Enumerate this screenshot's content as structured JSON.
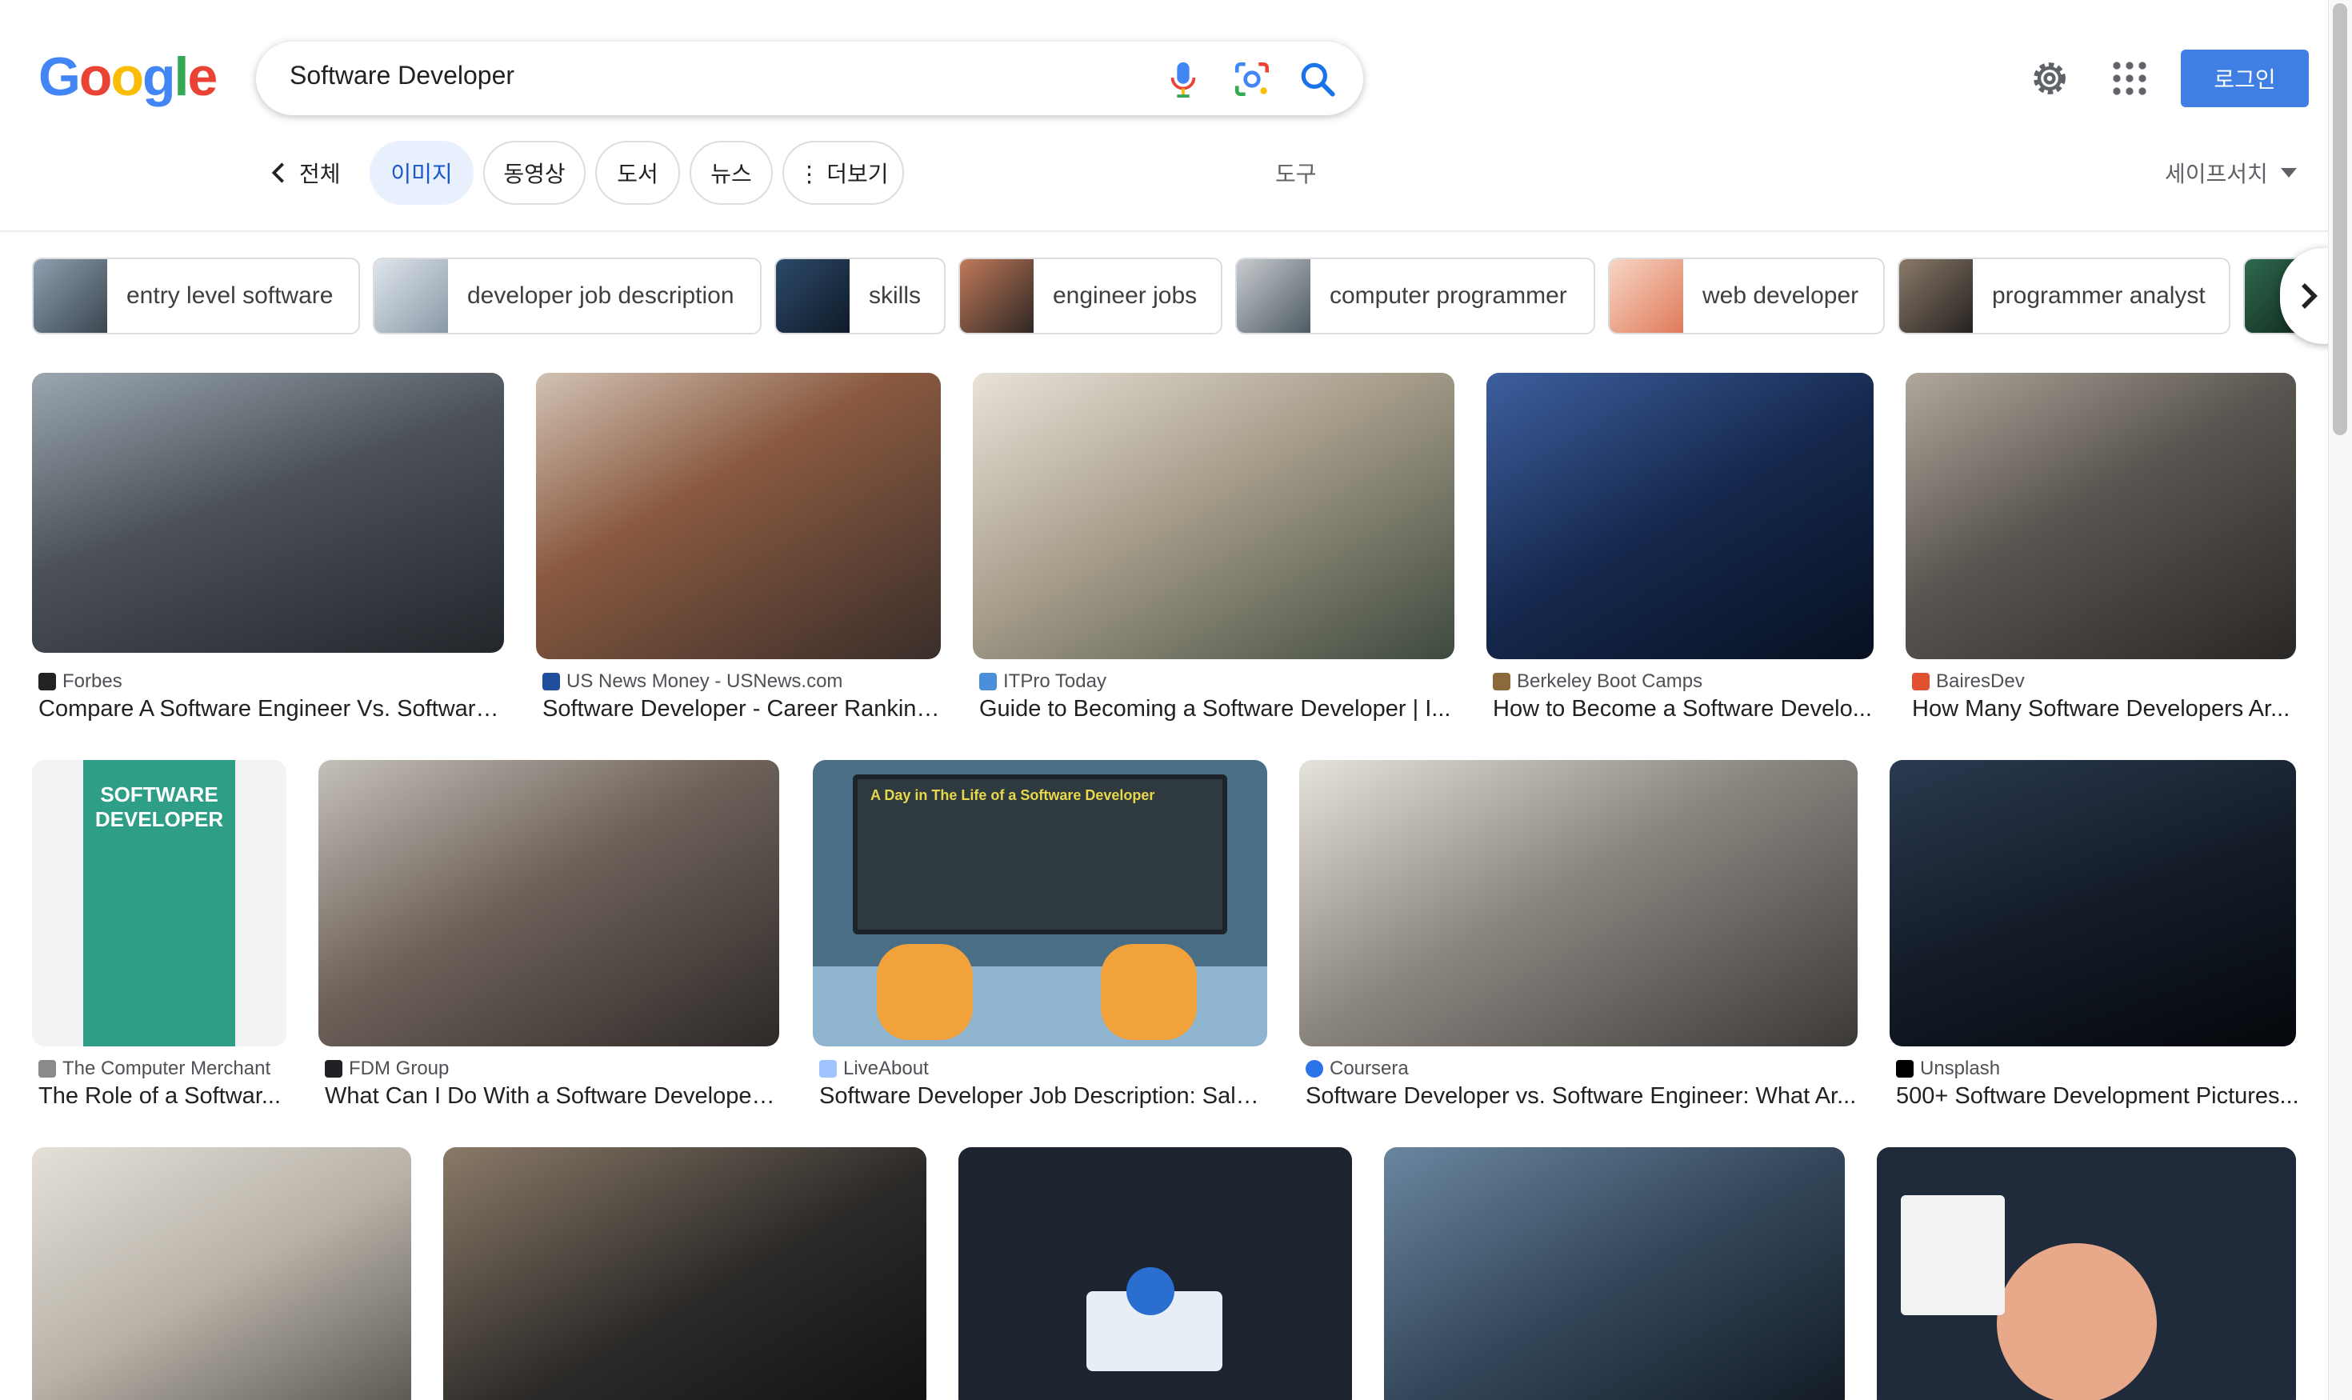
{
  "logo": {
    "letters": [
      "G",
      "o",
      "o",
      "g",
      "l",
      "e"
    ],
    "colors": [
      "#4285f4",
      "#ea4335",
      "#fbbc05",
      "#4285f4",
      "#34a853",
      "#ea4335"
    ]
  },
  "search": {
    "query": "Software Developer"
  },
  "header": {
    "login_label": "로그인"
  },
  "tabs": {
    "back_label": "전체",
    "items": [
      {
        "label": "이미지",
        "active": true
      },
      {
        "label": "동영상"
      },
      {
        "label": "도서"
      },
      {
        "label": "뉴스"
      },
      {
        "label": "⋮ 더보기"
      }
    ],
    "tools": "도구",
    "safesearch": "세이프서치"
  },
  "chips": [
    {
      "label": "entry level software",
      "color": "#5a6a7a"
    },
    {
      "label": "developer job description",
      "color": "#8a98a6"
    },
    {
      "label": "skills",
      "color": "#1f3348"
    },
    {
      "label": "engineer jobs",
      "color": "#4a3a34"
    },
    {
      "label": "computer programmer",
      "color": "#5e6a72"
    },
    {
      "label": "web developer",
      "color": "#e9a48a"
    },
    {
      "label": "programmer analyst",
      "color": "#3d3a36"
    }
  ],
  "results": [
    {
      "source": "Forbes",
      "title": "Compare A Software Engineer Vs. Software...",
      "color": "#4b5157",
      "fav": "#222222"
    },
    {
      "source": "US News Money - USNews.com",
      "title": "Software Developer - Career Ranking...",
      "color": "#5a4840",
      "fav": "#1f4e9c"
    },
    {
      "source": "ITPro Today",
      "title": "Guide to Becoming a Software Developer | I...",
      "color": "#a69c8a",
      "fav": "#4a8fd8"
    },
    {
      "source": "Berkeley Boot Camps",
      "title": "How to Become a Software Develo...",
      "color": "#15284d",
      "fav": "#8a6a3a"
    },
    {
      "source": "BairesDev",
      "title": "How Many Software Developers Ar...",
      "color": "#5a5550",
      "fav": "#e0512f"
    },
    {
      "source": "The Computer Merchant",
      "title": "The Role of a Softwar...",
      "color": "#2f9e86",
      "fav": "#8a8a8a"
    },
    {
      "source": "FDM Group",
      "title": "What Can I Do With a Software Developer ...",
      "color": "#4c4540",
      "fav": "#202124"
    },
    {
      "source": "LiveAbout",
      "title": "Software Developer Job Description: Sala...",
      "color": "#4a6e86",
      "fav": "#a0c4ff"
    },
    {
      "source": "Coursera",
      "title": "Software Developer vs. Software Engineer: What Ar...",
      "color": "#5c5a56",
      "fav": "#2a73e8"
    },
    {
      "source": "Unsplash",
      "title": "500+ Software Development Pictures...",
      "color": "#141c28",
      "fav": "#000000"
    },
    {
      "color": "#b8b2a8"
    },
    {
      "color": "#2c2a28"
    },
    {
      "color": "#1d2430"
    },
    {
      "color": "#34475a"
    },
    {
      "color": "#1f2a3a"
    }
  ],
  "lens_title": "A Day in The Life of a Software Developer",
  "infographic_title": "SOFTWARE DEVELOPER"
}
